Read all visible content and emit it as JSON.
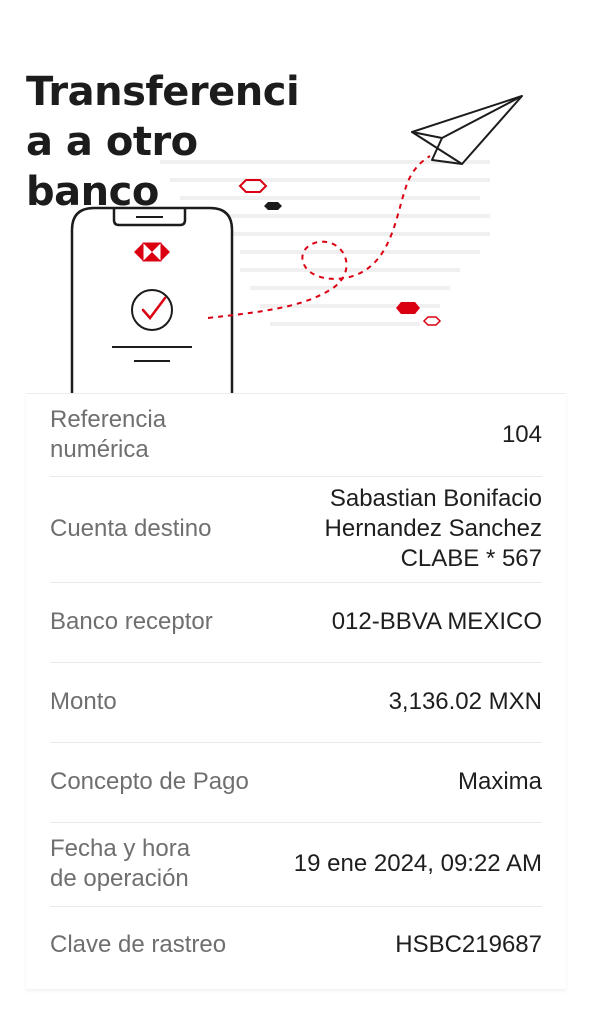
{
  "header": {
    "title_lines": [
      "Transferenci",
      "a a otro",
      "banco"
    ]
  },
  "illustration": {
    "icons": [
      "paper-plane-icon",
      "phone-icon",
      "hsbc-logo-icon",
      "check-circle-icon"
    ],
    "brand_color": "#db0011"
  },
  "details": {
    "referencia": {
      "label_lines": [
        "Referencia",
        "numérica"
      ],
      "value": "104"
    },
    "cuenta": {
      "label": "Cuenta destino",
      "value_lines": [
        "Sabastian Bonifacio",
        "Hernandez Sanchez",
        "CLABE * 567"
      ]
    },
    "banco": {
      "label": "Banco receptor",
      "value": "012-BBVA MEXICO"
    },
    "monto": {
      "label": "Monto",
      "value": "3,136.02 MXN"
    },
    "concepto": {
      "label": "Concepto de Pago",
      "value": "Maxima"
    },
    "fecha": {
      "label_lines": [
        "Fecha y hora",
        "de operación"
      ],
      "value": "19 ene 2024, 09:22 AM"
    },
    "clave": {
      "label": "Clave de rastreo",
      "value": "HSBC219687"
    }
  }
}
